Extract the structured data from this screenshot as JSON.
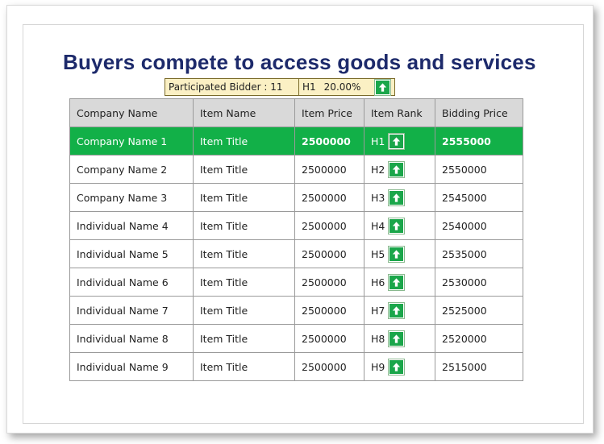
{
  "title": "Buyers compete to access goods and services",
  "bidder_bar": {
    "participated_label": "Participated Bidder : 11",
    "leading_rank": "H1",
    "percent": "20.00%"
  },
  "table": {
    "headers": [
      "Company Name",
      "Item Name",
      "Item Price",
      "Item Rank",
      "Bidding Price"
    ],
    "rows": [
      {
        "company": "Company Name 1",
        "item": "Item Title",
        "price": "2500000",
        "rank": "H1",
        "bid": "2555000"
      },
      {
        "company": "Company Name 2",
        "item": "Item Title",
        "price": "2500000",
        "rank": "H2",
        "bid": "2550000"
      },
      {
        "company": "Company Name 3",
        "item": "Item Title",
        "price": "2500000",
        "rank": "H3",
        "bid": "2545000"
      },
      {
        "company": "Individual Name 4",
        "item": "Item Title",
        "price": "2500000",
        "rank": "H4",
        "bid": "2540000"
      },
      {
        "company": "Individual Name 5",
        "item": "Item Title",
        "price": "2500000",
        "rank": "H5",
        "bid": "2535000"
      },
      {
        "company": "Individual Name 6",
        "item": "Item Title",
        "price": "2500000",
        "rank": "H6",
        "bid": "2530000"
      },
      {
        "company": "Individual Name 7",
        "item": "Item Title",
        "price": "2500000",
        "rank": "H7",
        "bid": "2525000"
      },
      {
        "company": "Individual Name 8",
        "item": "Item Title",
        "price": "2500000",
        "rank": "H8",
        "bid": "2520000"
      },
      {
        "company": "Individual Name 9",
        "item": "Item Title",
        "price": "2500000",
        "rank": "H9",
        "bid": "2515000"
      }
    ]
  },
  "colors": {
    "highlight_row": "#12b048",
    "rank_icon": "#1aa64a",
    "title": "#1d2a6b",
    "bidder_bar_bg": "#fbf0c4"
  },
  "icons": {
    "rank": "arrow-up-icon"
  }
}
